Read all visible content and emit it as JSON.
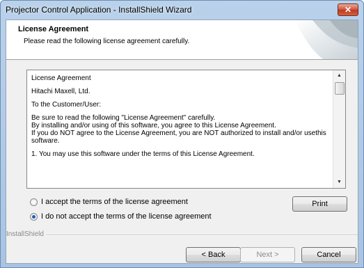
{
  "window": {
    "title": "Projector Control Application - InstallShield Wizard",
    "close_label": "✕"
  },
  "header": {
    "title": "License Agreement",
    "subtitle": "Please read the following license agreement carefully."
  },
  "license": {
    "paragraphs": [
      "License Agreement",
      "Hitachi Maxell, Ltd.",
      "To the Customer/User:",
      "Be sure to read the following \"License Agreement\" carefully.\nBy installing and/or using of this software, you agree to this License Agreement.\nIf you do NOT agree to the License Agreement, you are NOT authorized to install and/or usethis software.",
      "1. You may use this software under the terms of this License Agreement."
    ],
    "scroll_up_icon": "▲",
    "scroll_down_icon": "▼"
  },
  "options": {
    "accept_label": "I accept the terms of the license agreement",
    "decline_label": "I do not accept the terms of the license agreement",
    "selected": "decline"
  },
  "buttons": {
    "print": "Print",
    "back": "< Back",
    "next": "Next >",
    "cancel": "Cancel"
  },
  "footer": {
    "brand": "InstallShield"
  },
  "colors": {
    "title_bar": "#b9d1ea",
    "close_button": "#c0391f",
    "radio_selected": "#1f5fc1"
  }
}
